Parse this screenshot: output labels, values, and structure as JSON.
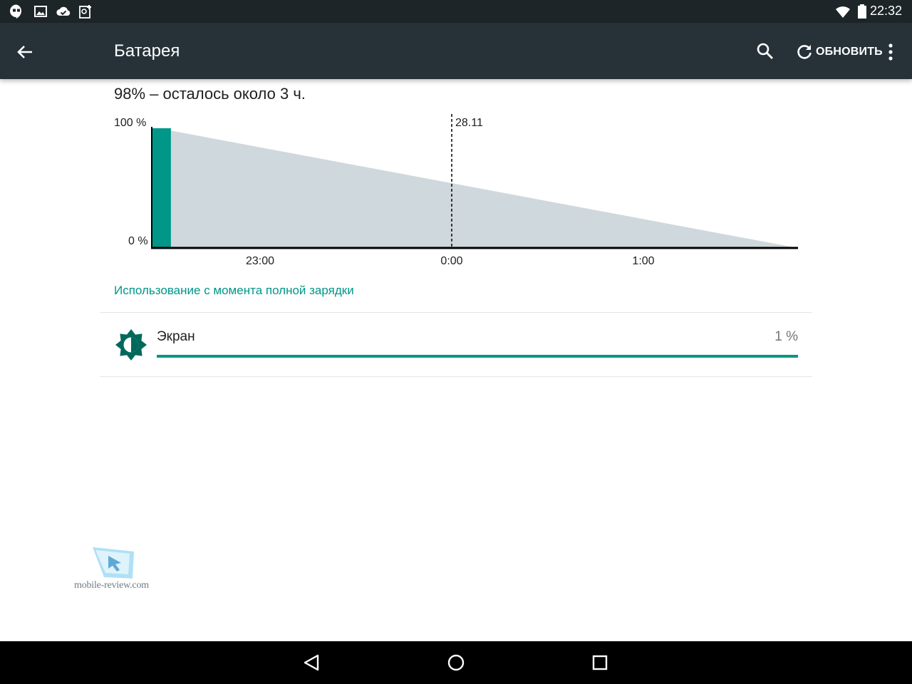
{
  "status_bar": {
    "time": "22:32",
    "left_icons": [
      "hangouts-icon",
      "gallery-icon",
      "cloud-check-icon",
      "google-plus-icon"
    ],
    "right_icons": [
      "wifi-icon",
      "battery-icon"
    ]
  },
  "app_bar": {
    "title": "Батарея",
    "refresh_label": "ОБНОВИТЬ",
    "background": "#263238"
  },
  "battery": {
    "summary": "98% – осталось около 3 ч."
  },
  "chart_data": {
    "type": "area",
    "y_labels": [
      "100 %",
      "0 %"
    ],
    "ylim": [
      0,
      100
    ],
    "x_tick_labels": [
      "23:00",
      "0:00",
      "1:00"
    ],
    "date_marker_label": "28.11",
    "actual_series": {
      "color": "#009688",
      "points": [
        [
          0,
          100
        ],
        [
          0.1,
          98
        ]
      ]
    },
    "projected_series": {
      "color": "#cfd8dc",
      "points": [
        [
          0.1,
          98
        ],
        [
          3.35,
          0
        ]
      ]
    }
  },
  "usage": {
    "header": "Использование с момента полной зарядки",
    "items": [
      {
        "label": "Экран",
        "percent_text": "1 %",
        "fraction": 1.0,
        "icon": "brightness-icon"
      }
    ]
  },
  "watermark": {
    "text": "mobile-review.com"
  },
  "nav_bar": {
    "buttons": [
      "back-nav-icon",
      "home-nav-icon",
      "recents-nav-icon"
    ]
  },
  "colors": {
    "accent": "#009688",
    "status_bar": "#1d2529",
    "nav_bar": "#000000"
  }
}
